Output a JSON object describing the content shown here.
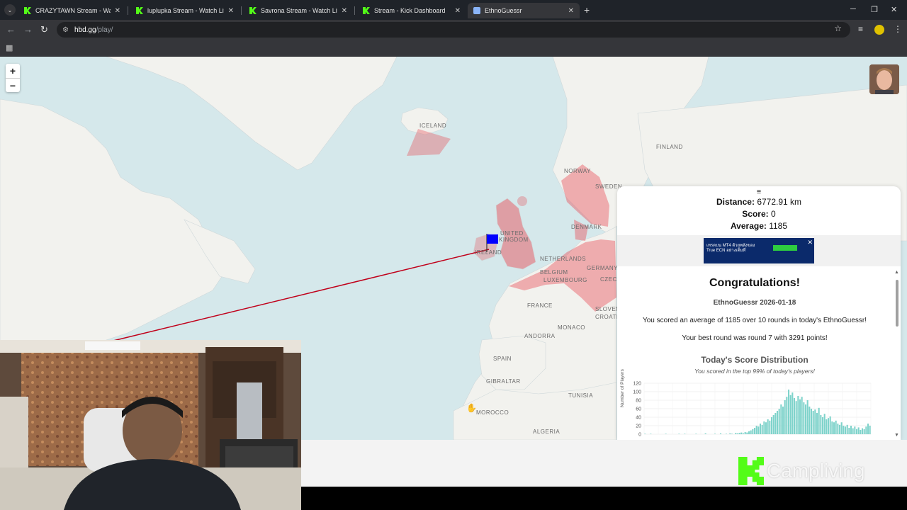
{
  "browser": {
    "tabs": [
      {
        "label": "CRAZYTAWN Stream - Watch Li",
        "icon": "kick-favicon"
      },
      {
        "label": "luplupka Stream - Watch Live o",
        "icon": "kick-favicon"
      },
      {
        "label": "Savrona Stream - Watch Live o",
        "icon": "kick-favicon"
      },
      {
        "label": "Stream - Kick Dashboard",
        "icon": "kick-favicon"
      },
      {
        "label": "EthnoGuessr",
        "icon": "ethnoguessr-favicon"
      }
    ],
    "url_host": "hbd.gg",
    "url_path": "/play/"
  },
  "map": {
    "labels": {
      "iceland": "ICELAND",
      "finland": "FINLAND",
      "norway": "NORWAY",
      "sweden": "SWEDEN",
      "united": "UNITED",
      "kingdom": "KINGDOM",
      "ireland": "IRELAND",
      "denmark": "DENMARK",
      "netherlands": "NETHERLANDS",
      "belgium": "BELGIUM",
      "luxembourg": "LUXEMBOURG",
      "germany": "GERMANY",
      "czech": "CZECHI",
      "france": "FRANCE",
      "slovenia": "SLOVEN",
      "croatia": "CROATIA",
      "monaco": "MONACO",
      "andorra": "ANDORRA",
      "spain": "SPAIN",
      "gibraltar": "GIBRALTAR",
      "tunisia": "TUNISIA",
      "morocco": "MOROCCO",
      "algeria": "ALGERIA"
    },
    "zoom_in": "+",
    "zoom_out": "−"
  },
  "result": {
    "menu_icon": "≡",
    "distance_label": "Distance:",
    "distance_value": "6772.91 km",
    "score_label": "Score:",
    "score_value": "0",
    "average_label": "Average:",
    "average_value": "1185",
    "ad_text": "เทรดบน MT4 ด้วยพลังของ True ECN อย่างเต็มที่",
    "ad_close": "✕",
    "congrats": "Congratulations!",
    "game_date": "EthnoGuessr 2026-01-18",
    "summary": "You scored an average of 1185 over 10 rounds in today's EthnoGuessr!",
    "best_round": "Your best round was round 7 with 3291 points!",
    "distribution_title": "Today's Score Distribution",
    "distribution_subtitle": "You scored in the top 99% of today's players!"
  },
  "chart_data": {
    "type": "bar",
    "ylabel": "Number of Players",
    "ylim": [
      0,
      120
    ],
    "yticks": [
      0,
      20,
      40,
      60,
      80,
      100,
      120
    ],
    "values": [
      1,
      0,
      0,
      1,
      0,
      0,
      0,
      0,
      0,
      0,
      0,
      1,
      0,
      0,
      0,
      0,
      0,
      0,
      1,
      0,
      0,
      1,
      0,
      0,
      0,
      0,
      0,
      1,
      0,
      0,
      0,
      0,
      2,
      0,
      0,
      0,
      0,
      1,
      0,
      0,
      2,
      0,
      0,
      1,
      0,
      2,
      1,
      0,
      3,
      2,
      3,
      4,
      2,
      5,
      4,
      7,
      9,
      12,
      15,
      20,
      18,
      25,
      22,
      30,
      28,
      35,
      32,
      40,
      45,
      50,
      55,
      60,
      70,
      65,
      80,
      88,
      105,
      92,
      98,
      85,
      78,
      90,
      82,
      88,
      75,
      70,
      80,
      65,
      60,
      55,
      58,
      50,
      62,
      45,
      40,
      48,
      35,
      38,
      42,
      30,
      28,
      32,
      25,
      22,
      28,
      20,
      18,
      22,
      15,
      20,
      14,
      18,
      12,
      16,
      10,
      14,
      12,
      18,
      25,
      20
    ]
  },
  "stream": {
    "channel_name": "Campliving"
  },
  "colors": {
    "map_water": "#d5e8eb",
    "map_land": "#f2f2ee",
    "highlight": "#e8444e",
    "bar": "#7fd3cb",
    "guess_flag": "#0000ff",
    "kick_green": "#53fc18"
  }
}
